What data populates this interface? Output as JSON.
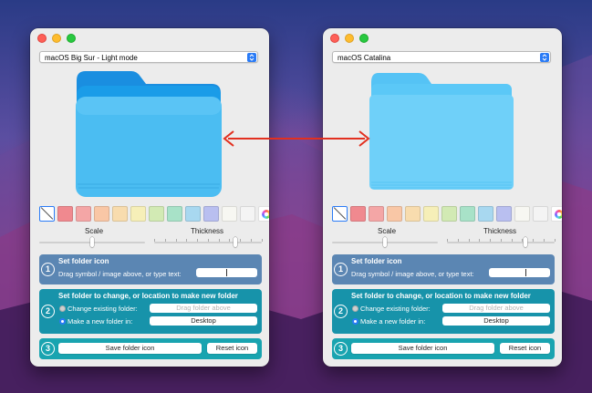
{
  "windows": {
    "left": {
      "theme_label": "macOS Big Sur - Light mode",
      "folder_style": "bigsur",
      "folder_colors": {
        "back": "#1a9ce8",
        "front": "#4bbdf2",
        "tab": "#1a8ee0"
      }
    },
    "right": {
      "theme_label": "macOS Catalina",
      "folder_style": "catalina",
      "folder_colors": {
        "back": "#5bc8f7",
        "front": "#6fd0f9",
        "tab": "#55c3f5"
      }
    }
  },
  "swatch_colors": [
    "#f0898f",
    "#f4a6a6",
    "#f9c7a6",
    "#f8dcae",
    "#f6efb8",
    "#d2eab4",
    "#a8e2c8",
    "#a8d8f0",
    "#b9bff0",
    "#f7f7f2",
    "#f4f4f4"
  ],
  "labels": {
    "scale": "Scale",
    "thickness": "Thickness",
    "step1_num": "1",
    "step2_num": "2",
    "step3_num": "3",
    "set_folder_icon": "Set folder icon",
    "drag_symbol": "Drag symbol / image above, or type text:",
    "set_folder_change": "Set folder to change, or location to make new folder",
    "change_existing": "Change existing folder:",
    "drag_folder_placeholder": "Drag folder above",
    "make_new_folder": "Make a new folder in:",
    "new_folder_location": "Desktop",
    "save_button": "Save folder icon",
    "reset_button": "Reset icon"
  },
  "sliders": {
    "scale_value": 0.31,
    "thickness_value": 0.76
  },
  "arrow_color": "#e2301f"
}
